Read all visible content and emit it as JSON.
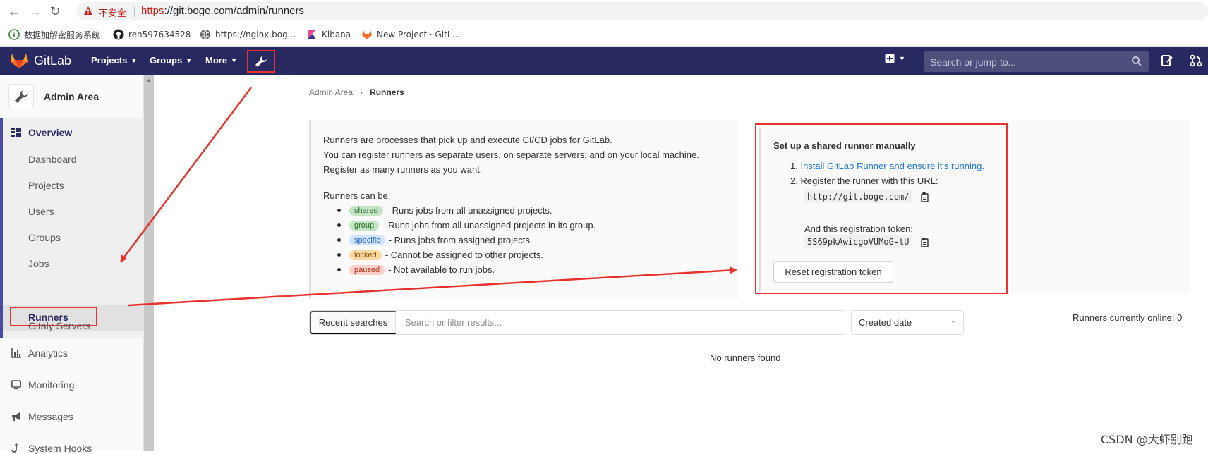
{
  "browser": {
    "warning_text": "不安全",
    "url_scheme": "https",
    "url_rest": "://git.boge.com/admin/runners",
    "bookmarks": [
      {
        "label": "数据加解密服务系统",
        "icon": "info-circle-icon"
      },
      {
        "label": "ren597634528",
        "icon": "github-icon"
      },
      {
        "label": "https://nginx.bog...",
        "icon": "globe-icon"
      },
      {
        "label": "Kibana",
        "icon": "kibana-icon"
      },
      {
        "label": "New Project · GitL...",
        "icon": "gitlab-icon"
      }
    ]
  },
  "navbar": {
    "brand": "GitLab",
    "projects": "Projects",
    "groups": "Groups",
    "more": "More",
    "search_placeholder": "Search or jump to...",
    "colors": {
      "bg": "#292961",
      "highlight": "#e8322f"
    }
  },
  "sidebar": {
    "title": "Admin Area",
    "overview": "Overview",
    "sub_items": [
      "Dashboard",
      "Projects",
      "Users",
      "Groups",
      "Jobs",
      "Runners",
      "Gitaly Servers"
    ],
    "active": "Runners",
    "items": [
      {
        "label": "Analytics",
        "icon": "chart-icon"
      },
      {
        "label": "Monitoring",
        "icon": "monitor-icon"
      },
      {
        "label": "Messages",
        "icon": "bullhorn-icon"
      },
      {
        "label": "System Hooks",
        "icon": "hook-icon"
      }
    ]
  },
  "breadcrumb": {
    "parent": "Admin Area",
    "current": "Runners"
  },
  "info": {
    "line1": "Runners are processes that pick up and execute CI/CD jobs for GitLab.",
    "line2": "You can register runners as separate users, on separate servers, and on your local machine.",
    "line3": "Register as many runners as you want.",
    "can_be": "Runners can be:",
    "types": [
      {
        "badge": "shared",
        "desc": "- Runs jobs from all unassigned projects."
      },
      {
        "badge": "group",
        "desc": "- Runs jobs from all unassigned projects in its group."
      },
      {
        "badge": "specific",
        "desc": "- Runs jobs from assigned projects."
      },
      {
        "badge": "locked",
        "desc": "- Cannot be assigned to other projects."
      },
      {
        "badge": "paused",
        "desc": "- Not available to run jobs."
      }
    ]
  },
  "setup": {
    "title": "Set up a shared runner manually",
    "step1_num": "1.",
    "step1_link": "Install GitLab Runner and ensure it's running.",
    "step2_num": "2.",
    "step2": "Register the runner with this URL:",
    "url": "http://git.boge.com/",
    "token_label": "And this registration token:",
    "token": "5S69pkAwicgoVUMoG-tU",
    "reset_button": "Reset registration token"
  },
  "filter": {
    "recent": "Recent searches",
    "placeholder": "Search or filter results...",
    "sort": "Created date",
    "online": "Runners currently online: 0",
    "empty": "No runners found"
  },
  "watermark": "CSDN @大虾别跑"
}
